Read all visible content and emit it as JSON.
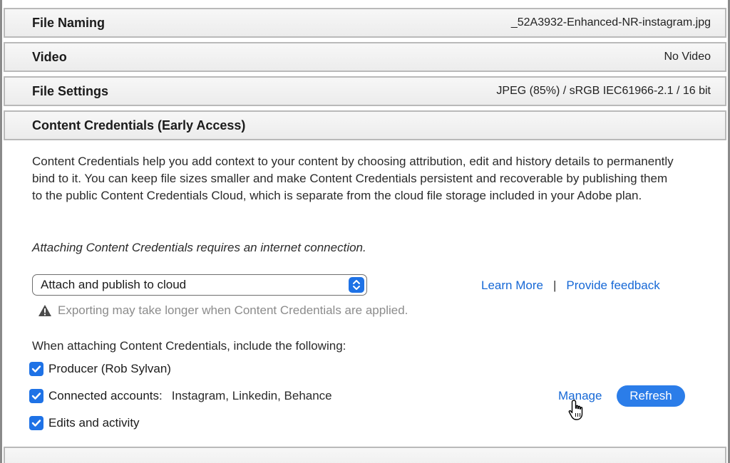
{
  "sections": {
    "file_naming": {
      "title": "File Naming",
      "summary": "_52A3932-Enhanced-NR-instagram.jpg"
    },
    "video": {
      "title": "Video",
      "summary": "No Video"
    },
    "file_settings": {
      "title": "File Settings",
      "summary": "JPEG (85%) / sRGB IEC61966-2.1 / 16 bit"
    },
    "content_credentials": {
      "title": "Content Credentials (Early Access)"
    }
  },
  "content_credentials": {
    "description": "Content Credentials help you add context to your content by choosing attribution, edit and history details to permanently bind to it. You can keep file sizes smaller and make Content Credentials persistent and recoverable by publishing them to the public Content Credentials Cloud, which is separate from the cloud file storage included in your Adobe plan.",
    "note": "Attaching Content Credentials requires an internet connection.",
    "mode_select": {
      "value": "Attach and publish to cloud"
    },
    "learn_more": "Learn More",
    "separator": "|",
    "feedback": "Provide feedback",
    "warning": "Exporting may take longer when Content Credentials are applied.",
    "include_label": "When attaching Content Credentials, include the following:",
    "producer": {
      "label": "Producer (Rob Sylvan)",
      "checked": true
    },
    "connected_accounts": {
      "label": "Connected accounts:",
      "value": "Instagram, Linkedin, Behance",
      "checked": true
    },
    "edits": {
      "label": "Edits and activity",
      "checked": true
    },
    "manage": "Manage",
    "refresh": "Refresh"
  },
  "colors": {
    "accent": "#1e72e6",
    "link": "#1668d6",
    "warning_text": "#8c8c8c"
  },
  "icons": [
    "chevron-updown-icon",
    "warning-icon",
    "checkmark-icon",
    "hand-pointer-icon"
  ]
}
